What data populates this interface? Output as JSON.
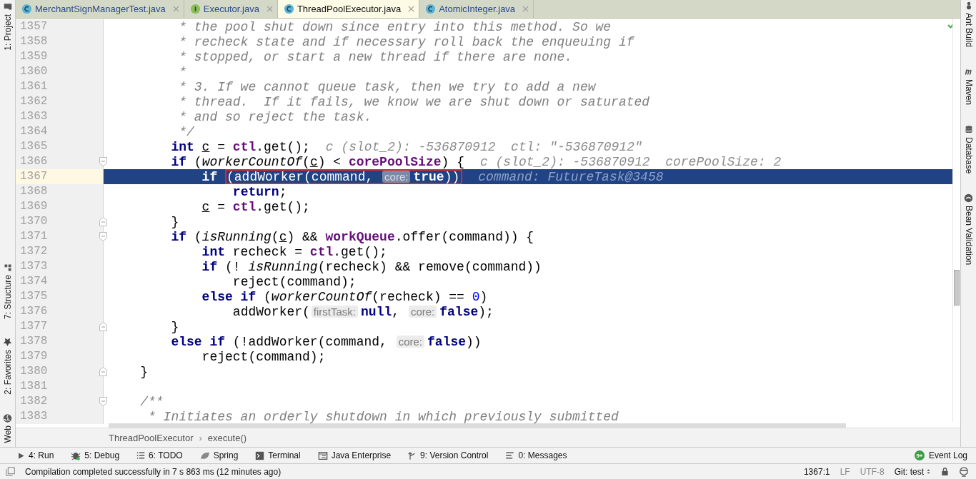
{
  "tabs": [
    {
      "label": "MerchantSignManagerTest.java",
      "kind": "class",
      "selected": false
    },
    {
      "label": "Executor.java",
      "kind": "interface",
      "selected": false
    },
    {
      "label": "ThreadPoolExecutor.java",
      "kind": "class",
      "selected": true
    },
    {
      "label": "AtomicInteger.java",
      "kind": "class",
      "selected": false
    }
  ],
  "left_toolbar": [
    {
      "label": "1: Project",
      "kind": "project"
    },
    {
      "label": "7: Structure",
      "kind": "structure"
    },
    {
      "label": "2: Favorites",
      "kind": "favorites"
    },
    {
      "label": "Web",
      "kind": "web"
    }
  ],
  "right_toolbar": [
    {
      "label": "Ant Build",
      "kind": "ant"
    },
    {
      "label": "Maven",
      "kind": "maven"
    },
    {
      "label": "Database",
      "kind": "database"
    },
    {
      "label": "Bean Validation",
      "kind": "bean"
    }
  ],
  "code": [
    {
      "children": [
        {
          "number": "1357",
          "selected": false,
          "fold_start": false,
          "fold_end": false,
          "tokens": [
            {
              "kind": "doc",
              "text": "* the pool shut down since entry into this method. So we"
            }
          ]
        },
        {
          "number": "1358",
          "selected": false,
          "fold_start": false,
          "fold_end": false,
          "tokens": [
            {
              "kind": "doc",
              "text": "* recheck state and if necessary roll back the enqueuing if"
            }
          ]
        },
        {
          "number": "1359",
          "selected": false,
          "fold_start": false,
          "fold_end": false,
          "tokens": [
            {
              "kind": "doc",
              "text": "* stopped, or start a new thread if there are none."
            }
          ]
        },
        {
          "number": "1360",
          "selected": false,
          "fold_start": false,
          "fold_end": false,
          "tokens": [
            {
              "kind": "doc",
              "text": "*"
            }
          ]
        },
        {
          "number": "1361",
          "selected": false,
          "fold_start": false,
          "fold_end": false,
          "tokens": [
            {
              "kind": "doc",
              "text": "* 3. If we cannot queue task, then we try to add a new"
            }
          ]
        },
        {
          "number": "1362",
          "selected": false,
          "fold_start": false,
          "fold_end": false,
          "tokens": [
            {
              "kind": "doc",
              "text": "* thread.  If it fails, we know we are shut down or saturated"
            }
          ]
        },
        {
          "number": "1363",
          "selected": false,
          "fold_start": false,
          "fold_end": false,
          "tokens": [
            {
              "kind": "doc",
              "text": "* and so reject the task."
            }
          ]
        },
        {
          "number": "1364",
          "selected": false,
          "fold_start": false,
          "fold_end": false,
          "tokens": [
            {
              "kind": "doc",
              "text": "*/"
            }
          ]
        },
        {
          "number": "1365",
          "selected": false,
          "fold_start": false,
          "fold_end": false,
          "tokens": [
            {
              "kind": "keyword",
              "text": "int"
            },
            {
              "kind": "variable",
              "text": "c"
            },
            {
              "kind": "plain",
              "text": " = "
            },
            {
              "kind": "field",
              "text": "ctl"
            },
            {
              "kind": "plain",
              "text": ".get();"
            },
            {
              "kind": "debug",
              "text": "c (slot_2): -536870912  ctl: \"-536870912\""
            }
          ]
        },
        {
          "number": "1366",
          "selected": false,
          "fold_start": true,
          "fold_end": false,
          "tokens": [
            {
              "kind": "keyword",
              "text": "if"
            },
            {
              "kind": "plain",
              "text": " ("
            },
            {
              "kind": "static",
              "text": "workerCountOf"
            },
            {
              "kind": "plain",
              "text": "("
            },
            {
              "kind": "variable",
              "text": "c"
            },
            {
              "kind": "plain",
              "text": ") < "
            },
            {
              "kind": "field",
              "text": "corePoolSize"
            },
            {
              "kind": "plain",
              "text": ") {"
            },
            {
              "kind": "debug",
              "text": "c (slot_2): -536870912  corePoolSize: 2"
            }
          ],
          "children": [
            {
              "number": "1367",
              "selected": true,
              "fold_start": false,
              "fold_end": false,
              "tokens": [
                {
                  "kind": "keyword",
                  "text": "if"
                },
                {
                  "kind": "box",
                  "tokens": [
                    {
                      "kind": "plain",
                      "text": "(addWorker(command, "
                    },
                    {
                      "kind": "hint",
                      "text": "core:"
                    },
                    {
                      "kind": "keyword",
                      "text": "true"
                    },
                    {
                      "kind": "plain",
                      "text": "))"
                    }
                  ]
                },
                {
                  "kind": "debug",
                  "text": "command: FutureTask@3458"
                }
              ],
              "children": [
                {
                  "number": "1368",
                  "selected": false,
                  "fold_start": false,
                  "fold_end": false,
                  "tokens": [
                    {
                      "kind": "keyword",
                      "text": "return"
                    },
                    {
                      "kind": "plain",
                      "text": ";"
                    }
                  ]
                }
              ]
            },
            {
              "number": "1369",
              "selected": false,
              "fold_start": false,
              "fold_end": false,
              "tokens": [
                {
                  "kind": "variable",
                  "text": "c"
                },
                {
                  "kind": "plain",
                  "text": " = "
                },
                {
                  "kind": "field",
                  "text": "ctl"
                },
                {
                  "kind": "plain",
                  "text": ".get();"
                }
              ]
            }
          ]
        },
        {
          "number": "1370",
          "selected": false,
          "fold_start": false,
          "fold_end": true,
          "tokens": [
            {
              "kind": "plain",
              "text": "}"
            }
          ]
        },
        {
          "number": "1371",
          "selected": false,
          "fold_start": true,
          "fold_end": false,
          "tokens": [
            {
              "kind": "keyword",
              "text": "if"
            },
            {
              "kind": "plain",
              "text": " ("
            },
            {
              "kind": "static",
              "text": "isRunning"
            },
            {
              "kind": "plain",
              "text": "("
            },
            {
              "kind": "variable",
              "text": "c"
            },
            {
              "kind": "plain",
              "text": ") && "
            },
            {
              "kind": "field",
              "text": "workQueue"
            },
            {
              "kind": "plain",
              "text": ".offer(command)) {"
            }
          ],
          "children": [
            {
              "number": "1372",
              "selected": false,
              "fold_start": false,
              "fold_end": false,
              "tokens": [
                {
                  "kind": "keyword",
                  "text": "int"
                },
                {
                  "kind": "plain",
                  "text": " recheck = "
                },
                {
                  "kind": "field",
                  "text": "ctl"
                },
                {
                  "kind": "plain",
                  "text": ".get();"
                }
              ]
            },
            {
              "number": "1373",
              "selected": false,
              "fold_start": false,
              "fold_end": false,
              "tokens": [
                {
                  "kind": "keyword",
                  "text": "if"
                },
                {
                  "kind": "plain",
                  "text": " (! "
                },
                {
                  "kind": "static",
                  "text": "isRunning"
                },
                {
                  "kind": "plain",
                  "text": "(recheck) && remove(command))"
                }
              ],
              "children": [
                {
                  "number": "1374",
                  "selected": false,
                  "fold_start": false,
                  "fold_end": false,
                  "tokens": [
                    {
                      "kind": "plain",
                      "text": "reject(command);"
                    }
                  ]
                }
              ]
            },
            {
              "number": "1375",
              "selected": false,
              "fold_start": false,
              "fold_end": false,
              "tokens": [
                {
                  "kind": "keyword",
                  "text": "else if"
                },
                {
                  "kind": "plain",
                  "text": " ("
                },
                {
                  "kind": "static",
                  "text": "workerCountOf"
                },
                {
                  "kind": "plain",
                  "text": "(recheck) == "
                },
                {
                  "kind": "number",
                  "text": "0"
                },
                {
                  "kind": "plain",
                  "text": ")"
                }
              ],
              "children": [
                {
                  "number": "1376",
                  "selected": false,
                  "fold_start": false,
                  "fold_end": false,
                  "tokens": [
                    {
                      "kind": "plain",
                      "text": "addWorker("
                    },
                    {
                      "kind": "hint",
                      "text": "firstTask:"
                    },
                    {
                      "kind": "keyword",
                      "text": "null"
                    },
                    {
                      "kind": "plain",
                      "text": ", "
                    },
                    {
                      "kind": "hint",
                      "text": "core:"
                    },
                    {
                      "kind": "keyword",
                      "text": "false"
                    },
                    {
                      "kind": "plain",
                      "text": ");"
                    }
                  ]
                }
              ]
            }
          ]
        },
        {
          "number": "1377",
          "selected": false,
          "fold_start": false,
          "fold_end": true,
          "tokens": [
            {
              "kind": "plain",
              "text": "}"
            }
          ]
        },
        {
          "number": "1378",
          "selected": false,
          "fold_start": false,
          "fold_end": false,
          "tokens": [
            {
              "kind": "keyword",
              "text": "else if"
            },
            {
              "kind": "plain",
              "text": " (!addWorker(command, "
            },
            {
              "kind": "hint",
              "text": "core:"
            },
            {
              "kind": "keyword",
              "text": "false"
            },
            {
              "kind": "plain",
              "text": "))"
            }
          ],
          "children": [
            {
              "number": "1379",
              "selected": false,
              "fold_start": false,
              "fold_end": false,
              "tokens": [
                {
                  "kind": "plain",
                  "text": "reject(command);"
                }
              ]
            }
          ]
        }
      ]
    },
    {
      "number": "1380",
      "selected": false,
      "fold_start": false,
      "fold_end": true,
      "tokens": [
        {
          "kind": "plain",
          "text": "}"
        }
      ]
    },
    {
      "number": "1381",
      "selected": false,
      "fold_start": false,
      "fold_end": false
    },
    {
      "number": "1382",
      "selected": false,
      "fold_start": true,
      "fold_end": false,
      "tokens": [
        {
          "kind": "comment",
          "text": "/**"
        }
      ]
    },
    {
      "number": "1383",
      "selected": false,
      "fold_start": false,
      "fold_end": false,
      "tokens": [
        {
          "kind": "doc",
          "text": "* Initiates an orderly shutdown in which previously submitted"
        }
      ]
    }
  ],
  "breadcrumbs": {
    "items": [
      "ThreadPoolExecutor",
      "execute()"
    ],
    "separator": "›"
  },
  "tool_windows": [
    {
      "label": "4: Run",
      "kind": "run"
    },
    {
      "label": "5: Debug",
      "kind": "debug"
    },
    {
      "label": "6: TODO",
      "kind": "todo"
    },
    {
      "label": "Spring",
      "kind": "spring"
    },
    {
      "label": "Terminal",
      "kind": "terminal"
    },
    {
      "label": "Java Enterprise",
      "kind": "javaee"
    },
    {
      "label": "9: Version Control",
      "kind": "vcs"
    },
    {
      "label": "0: Messages",
      "kind": "messages"
    }
  ],
  "event_log": {
    "label": "Event Log",
    "badge": "9+"
  },
  "status_bar": {
    "message": "Compilation completed successfully in 7 s 863 ms (12 minutes ago)",
    "position": "1367:1",
    "line_separator": "LF",
    "encoding": "UTF-8",
    "vcs": "Git: test"
  }
}
